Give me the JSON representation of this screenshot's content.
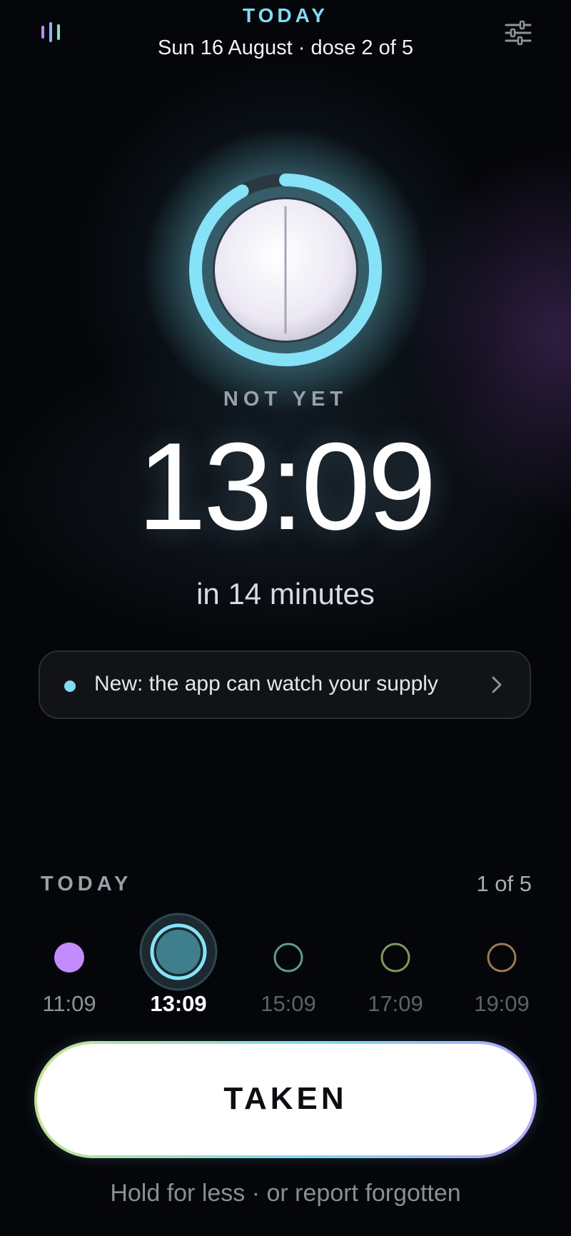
{
  "header": {
    "title": "TODAY",
    "subtitle": "Sun 16 August · dose 2 of 5",
    "left_icon": "stats-bars-icon",
    "right_icon": "settings-sliders-icon"
  },
  "dose_status": {
    "label": "NOT YET",
    "time": "13:09",
    "countdown": "in 14 minutes",
    "ring_progress": 0.92
  },
  "banner": {
    "text": "New: the app can watch your supply",
    "icon": "chevron-right-icon"
  },
  "schedule": {
    "title": "TODAY",
    "count": "1 of 5",
    "doses": [
      {
        "time": "11:09",
        "state": "taken",
        "color": "#c38bff"
      },
      {
        "time": "13:09",
        "state": "current",
        "color": "#7fdcf2"
      },
      {
        "time": "15:09",
        "state": "upcoming",
        "color": "#5f9e86"
      },
      {
        "time": "17:09",
        "state": "upcoming",
        "color": "#7f9a5a"
      },
      {
        "time": "19:09",
        "state": "upcoming",
        "color": "#9a7a50"
      }
    ]
  },
  "action": {
    "button_label": "TAKEN",
    "hint": "Hold for less · or report forgotten"
  },
  "colors": {
    "accent": "#7fdcf2",
    "background": "#05060a",
    "taken": "#c38bff"
  }
}
